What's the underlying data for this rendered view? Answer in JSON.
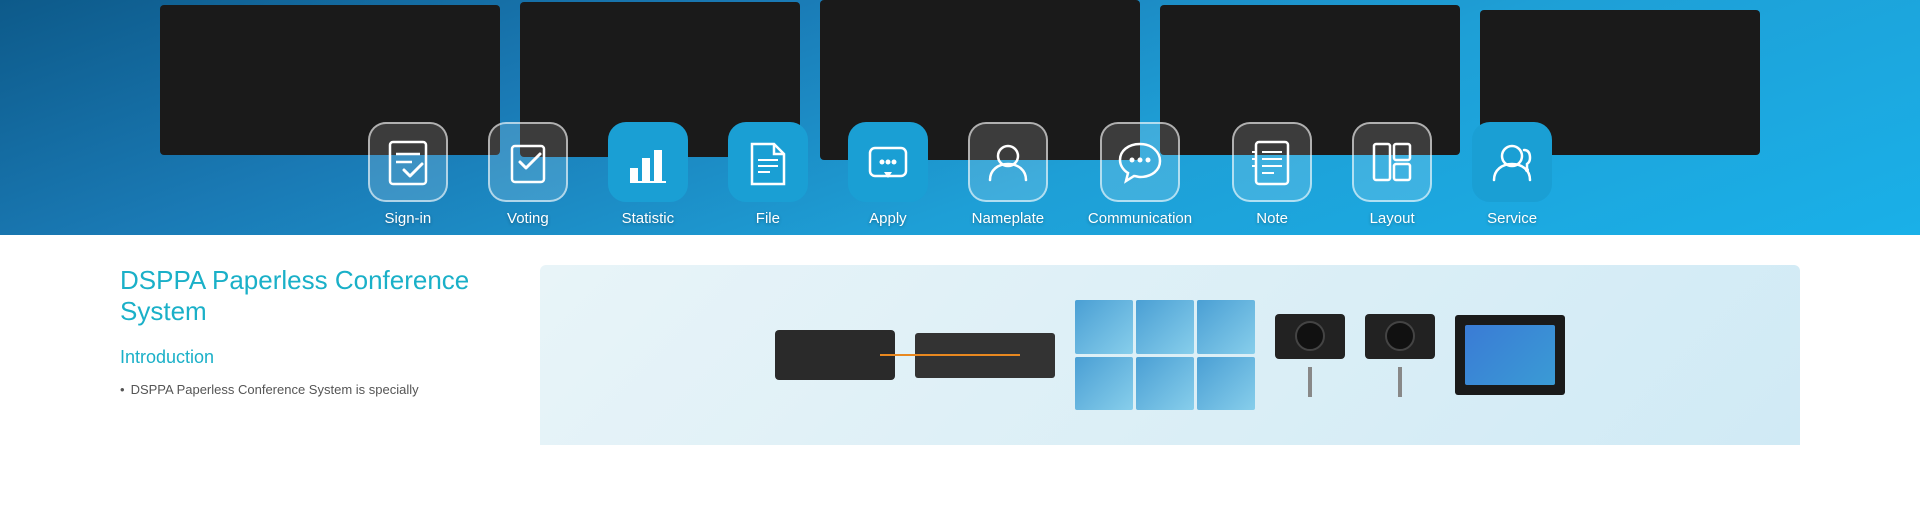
{
  "banner": {
    "icons": [
      {
        "id": "sign-in",
        "label": "Sign-in",
        "active": false
      },
      {
        "id": "voting",
        "label": "Voting",
        "active": false
      },
      {
        "id": "statistic",
        "label": "Statistic",
        "active": true
      },
      {
        "id": "file",
        "label": "File",
        "active": true
      },
      {
        "id": "apply",
        "label": "Apply",
        "active": true
      },
      {
        "id": "nameplate",
        "label": "Nameplate",
        "active": false
      },
      {
        "id": "communication",
        "label": "Communication",
        "active": false
      },
      {
        "id": "note",
        "label": "Note",
        "active": false
      },
      {
        "id": "layout",
        "label": "Layout",
        "active": false
      },
      {
        "id": "service",
        "label": "Service",
        "active": true
      }
    ]
  },
  "main": {
    "title": "DSPPA Paperless Conference System",
    "intro_heading": "Introduction",
    "intro_text": "DSPPA Paperless Conference System is specially"
  }
}
